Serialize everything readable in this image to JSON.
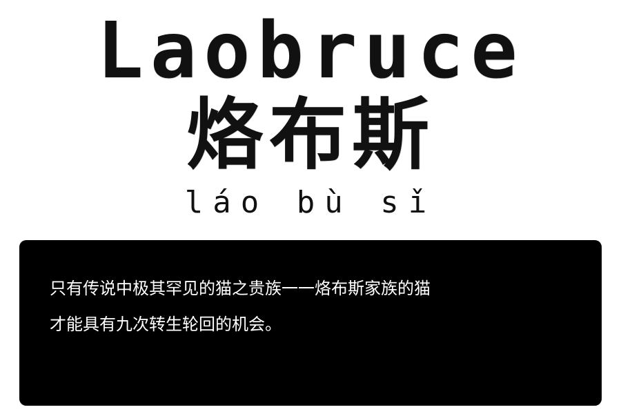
{
  "title": {
    "english": "Laobruce",
    "chinese": "烙布斯",
    "pinyin": "láo bù sǐ"
  },
  "dialog": {
    "lines": [
      "只有传说中极其罕见的猫之贵族一一烙布斯家族的猫",
      "才能具有九次转生轮回的机会。"
    ]
  }
}
